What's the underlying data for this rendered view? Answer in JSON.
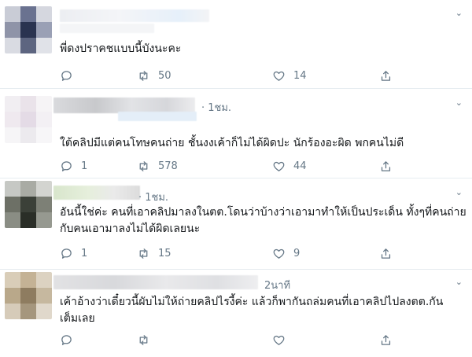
{
  "tweets": [
    {
      "time": "",
      "text_lines": [
        "พี่ดงปราคชแบบนี้บังนะคะ"
      ],
      "replies": "",
      "retweets": "50",
      "likes": "14"
    },
    {
      "time": "· 1ชม.",
      "text_lines": [
        "ใต้คลิปมีแต่คนโทษคนถ่าย ชั้นงงเค้าก็ไม่ได้ผิดปะ นักร้องอะผิด พกคนไม่ดี"
      ],
      "replies": "1",
      "retweets": "578",
      "likes": "44"
    },
    {
      "time": "· 1ชม.",
      "text_lines": [
        "อันนี้ใช่ค่ะ คนที่เอาคลิปมาลงในตต.โดนว่าบ้างว่าเอามาทำให้เป็นประเด็น ทั้งๆที่คนถ่าย",
        "กับคนเอามาลงไม่ได้ผิดเลยนะ"
      ],
      "replies": "1",
      "retweets": "15",
      "likes": "9"
    },
    {
      "time": "2นาที",
      "text_lines": [
        "เค้าอ้างว่าเดี๋ยวนี้ผับไม่ให้ถ่ายคลิปไรงี้ค่ะ แล้วก็พากันถล่มคนที่เอาคลิปไปลงตต.กัน",
        "เต็มเลย"
      ],
      "replies": "",
      "retweets": "",
      "likes": ""
    }
  ],
  "icons": {
    "reply": "reply-icon",
    "retweet": "retweet-icon",
    "like": "heart-icon",
    "share": "share-icon",
    "more": "chevron-down-icon"
  },
  "colors": {
    "secondary_text": "#657786",
    "divider": "#e6ecf0"
  }
}
